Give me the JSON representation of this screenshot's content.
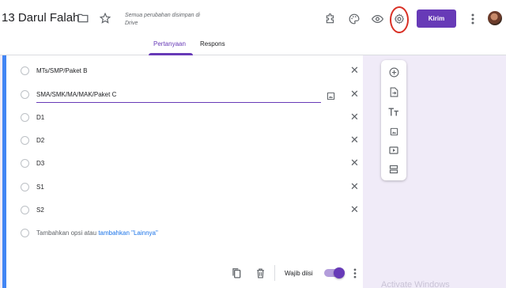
{
  "header": {
    "title": "13 Darul Falah",
    "save_note": "Semua perubahan disimpan di Drive",
    "send_label": "Kirim"
  },
  "tabs": [
    {
      "label": "Pertanyaan",
      "active": true
    },
    {
      "label": "Respons",
      "active": false
    }
  ],
  "question": {
    "options": [
      {
        "label": "MTs/SMP/Paket B"
      },
      {
        "label": "SMA/SMK/MA/MAK/Paket C",
        "editing": true
      },
      {
        "label": "D1"
      },
      {
        "label": "D2"
      },
      {
        "label": "D3"
      },
      {
        "label": "S1"
      },
      {
        "label": "S2"
      }
    ],
    "add_option": "Tambahkan opsi",
    "or": "atau",
    "add_other": "tambahkan \"Lainnya\""
  },
  "footer": {
    "required_label": "Wajib diisi",
    "required_on": true
  },
  "watermark": "Activate Windows",
  "colors": {
    "accent": "#673ab7",
    "card_bar": "#4285f4",
    "background": "#f0ebf8",
    "highlight": "#d93025"
  }
}
